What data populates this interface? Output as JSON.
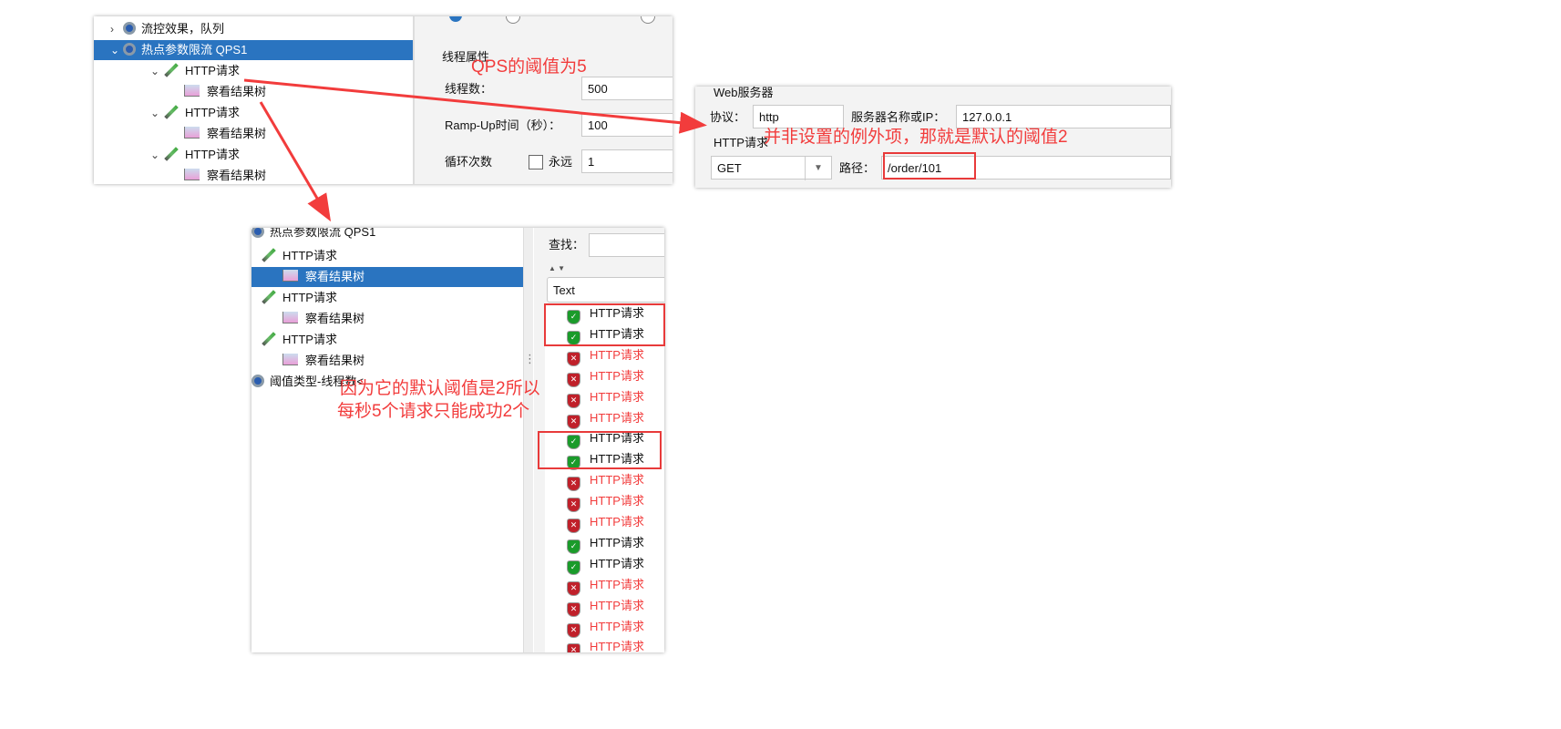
{
  "top_tree": {
    "items": [
      {
        "label": "流控效果，队列",
        "chevron": ">",
        "icon": "gear-icon"
      },
      {
        "label": "热点参数限流 QPS1",
        "chevron": "v",
        "icon": "gear-icon",
        "selected": true
      },
      {
        "label": "HTTP请求",
        "chevron": "v",
        "icon": "pipette-icon"
      },
      {
        "label": "察看结果树",
        "icon": "result-tree-icon"
      },
      {
        "label": "HTTP请求",
        "chevron": "v",
        "icon": "pipette-icon"
      },
      {
        "label": "察看结果树",
        "icon": "result-tree-icon"
      },
      {
        "label": "HTTP请求",
        "chevron": "v",
        "icon": "pipette-icon"
      },
      {
        "label": "察看结果树",
        "icon": "result-tree-icon"
      }
    ]
  },
  "thread_props": {
    "section": "线程属性",
    "threads_label": "线程数：",
    "threads": "500",
    "rampup_label": "Ramp-Up时间（秒）：",
    "rampup": "100",
    "loop_label": "循环次数",
    "forever_label": "永远",
    "forever_checked": false,
    "loop": "1"
  },
  "web_server": {
    "section": "Web服务器",
    "protocol_label": "协议：",
    "protocol": "http",
    "server_label": "服务器名称或IP：",
    "server": "127.0.0.1",
    "http_section": "HTTP请求",
    "method": "GET",
    "path_label": "路径：",
    "path": "/order/101"
  },
  "bottom_tree": {
    "items": [
      {
        "label": "热点参数限流 QPS1",
        "icon": "gear-icon"
      },
      {
        "label": "HTTP请求",
        "icon": "pipette-icon"
      },
      {
        "label": "察看结果树",
        "icon": "result-tree-icon",
        "selected": true
      },
      {
        "label": "HTTP请求",
        "icon": "pipette-icon"
      },
      {
        "label": "察看结果树",
        "icon": "result-tree-icon"
      },
      {
        "label": "HTTP请求",
        "icon": "pipette-icon"
      },
      {
        "label": "察看结果树",
        "icon": "result-tree-icon"
      },
      {
        "label": "阈值类型-线程数<",
        "icon": "gear-icon"
      }
    ]
  },
  "results": {
    "search_label": "查找：",
    "search_value": "",
    "renderer": "Text",
    "items": [
      {
        "label": "HTTP请求",
        "status": "success"
      },
      {
        "label": "HTTP请求",
        "status": "success"
      },
      {
        "label": "HTTP请求",
        "status": "fail"
      },
      {
        "label": "HTTP请求",
        "status": "fail"
      },
      {
        "label": "HTTP请求",
        "status": "fail"
      },
      {
        "label": "HTTP请求",
        "status": "fail"
      },
      {
        "label": "HTTP请求",
        "status": "success"
      },
      {
        "label": "HTTP请求",
        "status": "success"
      },
      {
        "label": "HTTP请求",
        "status": "fail"
      },
      {
        "label": "HTTP请求",
        "status": "fail"
      },
      {
        "label": "HTTP请求",
        "status": "fail"
      },
      {
        "label": "HTTP请求",
        "status": "success"
      },
      {
        "label": "HTTP请求",
        "status": "success"
      },
      {
        "label": "HTTP请求",
        "status": "fail"
      },
      {
        "label": "HTTP请求",
        "status": "fail"
      },
      {
        "label": "HTTP请求",
        "status": "fail"
      },
      {
        "label": "HTTP请求",
        "status": "fail"
      }
    ]
  },
  "annotations": {
    "qps": "QPS的阈值为5",
    "exception": "并非设置的例外项，那就是默认的阈值2",
    "reason_line1": "因为它的默认阈值是2所以",
    "reason_line2": "每秒5个请求只能成功2个"
  },
  "colors": {
    "annotation": "#f23c3c",
    "selection": "#2a74c0",
    "success": "#1a9b2a",
    "fail": "#c0202a"
  }
}
